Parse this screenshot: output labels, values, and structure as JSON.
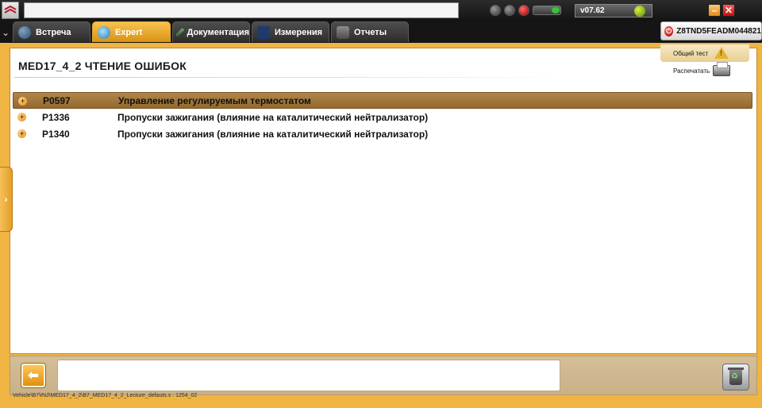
{
  "tabs": [
    {
      "label": "Встреча"
    },
    {
      "label": "Expert"
    },
    {
      "label": "Документация"
    },
    {
      "label": "Измерения"
    },
    {
      "label": "Отчеты"
    }
  ],
  "version": "v07.62",
  "vin": "Z8TND5FEADM044821",
  "page_title": "MED17_4_2  ЧТЕНИЕ ОШИБОК",
  "side_panel": {
    "general_test": "Общий тест",
    "print": "Распечатать"
  },
  "faults": [
    {
      "code": "P0597",
      "description": "Управление регулируемым термостатом",
      "selected": true
    },
    {
      "code": "P1336",
      "description": "Пропуски зажигания (влияние на каталитический нейтрализатор)",
      "selected": false
    },
    {
      "code": "P1340",
      "description": "Пропуски зажигания (влияние на каталитический нейтрализатор)",
      "selected": false
    }
  ],
  "path": "Vehicle\\B7\\INJ\\MED17_4_2\\B7_MED17_4_2_Lecture_defauts.s : 1254_02",
  "colors": {
    "accent": "#f0b443",
    "selected_row": "#a07a3e",
    "tab_active": "#e8a62a"
  }
}
